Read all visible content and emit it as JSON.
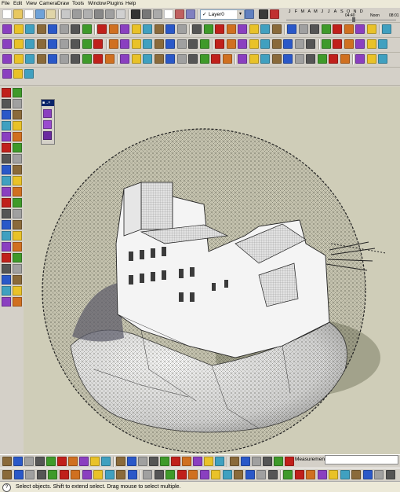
{
  "menu": {
    "items": [
      "File",
      "Edit",
      "View",
      "Camera",
      "Draw",
      "Tools",
      "Window",
      "Plugins",
      "Help"
    ]
  },
  "layers": {
    "current": "Layer0",
    "check_glyph": "✓",
    "arrow_glyph": "▾"
  },
  "shadows": {
    "months": [
      "J",
      "F",
      "M",
      "A",
      "M",
      "J",
      "J",
      "A",
      "S",
      "O",
      "N",
      "D"
    ],
    "time_left": "04:40",
    "time_mid": "Noon",
    "time_right": "08:01",
    "time_fraction": 0.62
  },
  "palette": {
    "title": "■ ..×"
  },
  "measurements": {
    "label": "Measurements",
    "value": ""
  },
  "status": {
    "icon": "?",
    "text": "Select objects. Shift to extend select. Drag mouse to select multiple."
  },
  "colors": {
    "viewport_bg": "#cfcdb8",
    "toolbar_bg": "#d4d0c8",
    "menubar_bg": "#ece9d8",
    "accent_red": "#c0201b",
    "accent_yellow": "#e9c228",
    "accent_blue": "#2a58c8",
    "accent_green": "#3f9a2a",
    "accent_purple": "#8a3fc0"
  }
}
